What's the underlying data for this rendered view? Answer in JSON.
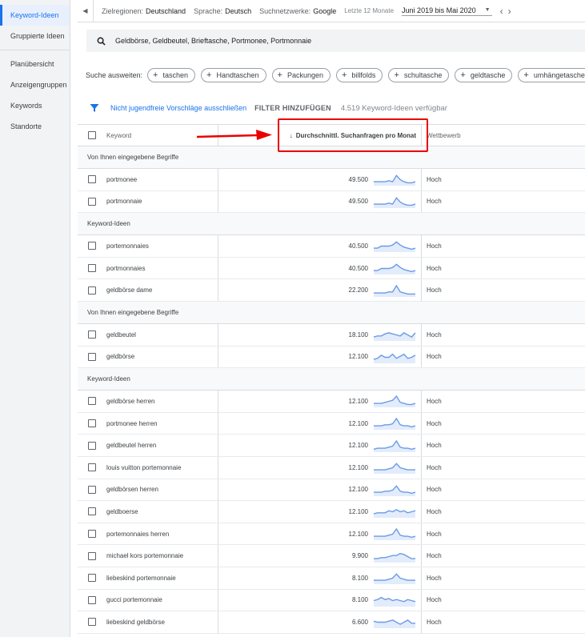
{
  "sidebar": {
    "items": [
      {
        "label": "Keyword-Ideen",
        "active": true
      },
      {
        "label": "Gruppierte Ideen"
      },
      {
        "label": "Planübersicht"
      },
      {
        "label": "Anzeigengruppen"
      },
      {
        "label": "Keywords"
      },
      {
        "label": "Standorte"
      }
    ]
  },
  "topbar": {
    "regions_label": "Zielregionen:",
    "regions_value": "Deutschland",
    "language_label": "Sprache:",
    "language_value": "Deutsch",
    "network_label": "Suchnetzwerke:",
    "network_value": "Google",
    "period_label": "Letzte 12 Monate",
    "period_value": "Juni 2019 bis Mai 2020"
  },
  "search": {
    "value": "Geldbörse, Geldbeutel, Brieftasche, Portmonee, Portmonnaie"
  },
  "expand": {
    "label": "Suche ausweiten:",
    "chips": [
      "taschen",
      "Handtaschen",
      "Packungen",
      "billfolds",
      "schultasche",
      "geldtasche",
      "umhängetasche"
    ]
  },
  "filter": {
    "link": "Nicht jugendfreie Vorschläge ausschließen",
    "button": "FILTER HINZUFÜGEN",
    "count": "4.519 Keyword-Ideen verfügbar"
  },
  "table": {
    "columns": {
      "keyword": "Keyword",
      "avg": "Durchschnittl. Suchanfragen pro Monat",
      "competition": "Wettbewerb"
    },
    "groups": [
      {
        "title": "Von Ihnen eingegebene Begriffe",
        "rows": [
          {
            "keyword": "portmonee",
            "avg": "49.500",
            "competition": "Hoch",
            "trend": [
              3,
              3,
              3,
              3,
              4,
              3,
              9,
              5,
              3,
              2,
              2,
              3
            ]
          },
          {
            "keyword": "portmonnaie",
            "avg": "49.500",
            "competition": "Hoch",
            "trend": [
              3,
              3,
              3,
              3,
              4,
              3,
              9,
              5,
              3,
              2,
              2,
              3
            ]
          }
        ]
      },
      {
        "title": "Keyword-Ideen",
        "rows": [
          {
            "keyword": "portemonnaies",
            "avg": "40.500",
            "competition": "Hoch",
            "trend": [
              3,
              3,
              5,
              5,
              5,
              6,
              9,
              6,
              4,
              3,
              2,
              3
            ]
          },
          {
            "keyword": "portmonnaies",
            "avg": "40.500",
            "competition": "Hoch",
            "trend": [
              3,
              3,
              5,
              5,
              5,
              6,
              9,
              6,
              4,
              3,
              2,
              3
            ]
          },
          {
            "keyword": "geldbörse dame",
            "avg": "22.200",
            "competition": "Hoch",
            "trend": [
              3,
              3,
              3,
              3,
              4,
              4,
              10,
              4,
              3,
              2,
              2,
              2
            ]
          }
        ]
      },
      {
        "title": "Von Ihnen eingegebene Begriffe",
        "rows": [
          {
            "keyword": "geldbeutel",
            "avg": "18.100",
            "competition": "Hoch",
            "trend": [
              3,
              4,
              4,
              6,
              7,
              6,
              5,
              4,
              7,
              5,
              3,
              7
            ]
          },
          {
            "keyword": "geldbörse",
            "avg": "12.100",
            "competition": "Hoch",
            "trend": [
              3,
              4,
              7,
              5,
              5,
              8,
              4,
              6,
              8,
              4,
              5,
              7
            ]
          }
        ]
      },
      {
        "title": "Keyword-Ideen",
        "rows": [
          {
            "keyword": "geldbörse herren",
            "avg": "12.100",
            "competition": "Hoch",
            "trend": [
              3,
              3,
              3,
              4,
              5,
              6,
              10,
              4,
              3,
              2,
              2,
              3
            ]
          },
          {
            "keyword": "portmonee herren",
            "avg": "12.100",
            "competition": "Hoch",
            "trend": [
              3,
              3,
              3,
              4,
              4,
              5,
              10,
              4,
              3,
              3,
              2,
              3
            ]
          },
          {
            "keyword": "geldbeutel herren",
            "avg": "12.100",
            "competition": "Hoch",
            "trend": [
              2,
              3,
              3,
              3,
              4,
              5,
              10,
              4,
              3,
              3,
              2,
              3
            ]
          },
          {
            "keyword": "louis vuitton portemonnaie",
            "avg": "12.100",
            "competition": "Hoch",
            "trend": [
              3,
              3,
              3,
              3,
              4,
              5,
              9,
              5,
              4,
              3,
              3,
              3
            ]
          },
          {
            "keyword": "geldbörsen herren",
            "avg": "12.100",
            "competition": "Hoch",
            "trend": [
              3,
              3,
              3,
              4,
              4,
              5,
              9,
              4,
              3,
              3,
              2,
              3
            ]
          },
          {
            "keyword": "geldboerse",
            "avg": "12.100",
            "competition": "Hoch",
            "trend": [
              3,
              4,
              4,
              4,
              6,
              5,
              7,
              5,
              6,
              4,
              5,
              6
            ]
          },
          {
            "keyword": "portemonnaies herren",
            "avg": "12.100",
            "competition": "Hoch",
            "trend": [
              3,
              3,
              3,
              3,
              4,
              5,
              10,
              4,
              3,
              3,
              2,
              3
            ]
          },
          {
            "keyword": "michael kors portemonnaie",
            "avg": "9.900",
            "competition": "Hoch",
            "trend": [
              3,
              3,
              4,
              4,
              5,
              6,
              6,
              8,
              7,
              5,
              3,
              3
            ]
          },
          {
            "keyword": "liebeskind portemonnaie",
            "avg": "8.100",
            "competition": "Hoch",
            "trend": [
              3,
              3,
              3,
              3,
              4,
              5,
              9,
              5,
              4,
              3,
              3,
              3
            ]
          },
          {
            "keyword": "gucci portemonnaie",
            "avg": "8.100",
            "competition": "Hoch",
            "trend": [
              5,
              6,
              8,
              6,
              7,
              5,
              6,
              5,
              4,
              6,
              5,
              4
            ]
          },
          {
            "keyword": "liebeskind geldbörse",
            "avg": "6.600",
            "competition": "Hoch",
            "trend": [
              6,
              5,
              5,
              5,
              6,
              7,
              5,
              3,
              5,
              7,
              4,
              4
            ]
          }
        ]
      }
    ]
  },
  "colors": {
    "accent": "#1a73e8",
    "sparkline": "#6b9ae8",
    "sparkline_fill": "#e3ecfb",
    "annotation": "#ea0000"
  }
}
